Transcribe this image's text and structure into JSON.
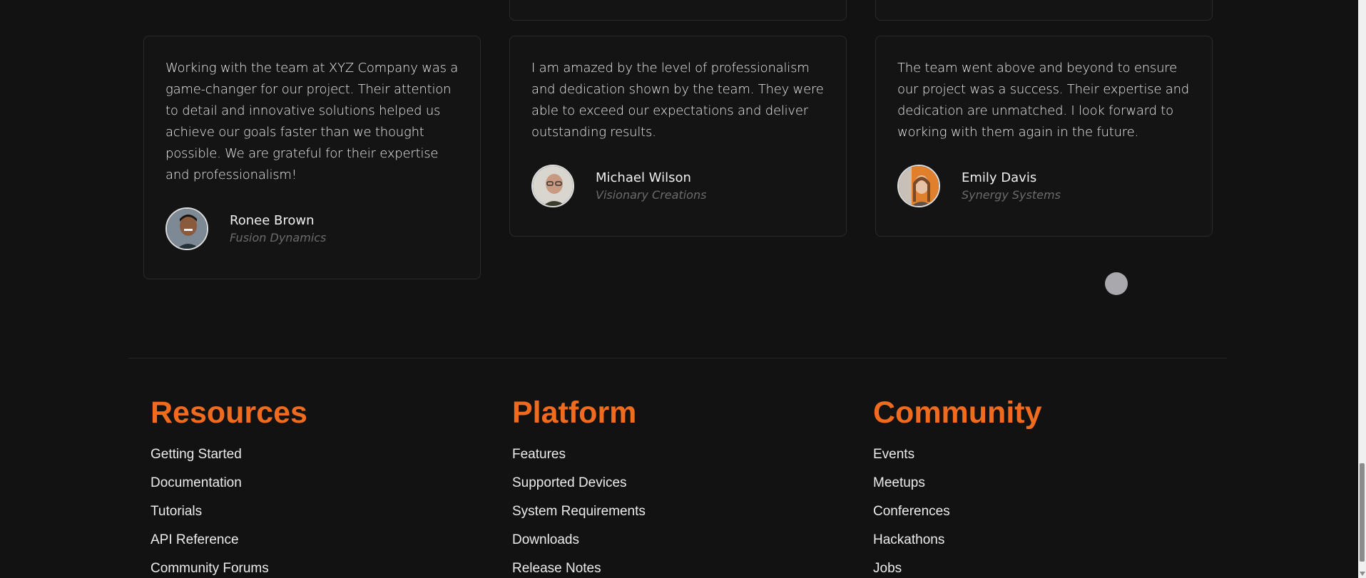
{
  "testimonials": [
    {
      "quote": "Working with the team at XYZ Company was a game-changer for our project. Their attention to detail and innovative solutions helped us achieve our goals faster than we thought possible. We are grateful for their expertise and professionalism!",
      "name": "Ronee Brown",
      "company": "Fusion Dynamics"
    },
    {
      "quote": "I am amazed by the level of professionalism and dedication shown by the team. They were able to exceed our expectations and deliver outstanding results.",
      "name": "Michael Wilson",
      "company": "Visionary Creations"
    },
    {
      "quote": "The team went above and beyond to ensure our project was a success. Their expertise and dedication are unmatched. I look forward to working with them again in the future.",
      "name": "Emily Davis",
      "company": "Synergy Systems"
    }
  ],
  "footer": {
    "columns": [
      {
        "heading": "Resources",
        "links": [
          "Getting Started",
          "Documentation",
          "Tutorials",
          "API Reference",
          "Community Forums"
        ]
      },
      {
        "heading": "Platform",
        "links": [
          "Features",
          "Supported Devices",
          "System Requirements",
          "Downloads",
          "Release Notes"
        ]
      },
      {
        "heading": "Community",
        "links": [
          "Events",
          "Meetups",
          "Conferences",
          "Hackathons",
          "Jobs"
        ]
      }
    ]
  },
  "colors": {
    "background": "#121212",
    "accent": "#f06b1d",
    "card_border": "#2a2a2a",
    "muted_text": "#6b6b6b"
  }
}
